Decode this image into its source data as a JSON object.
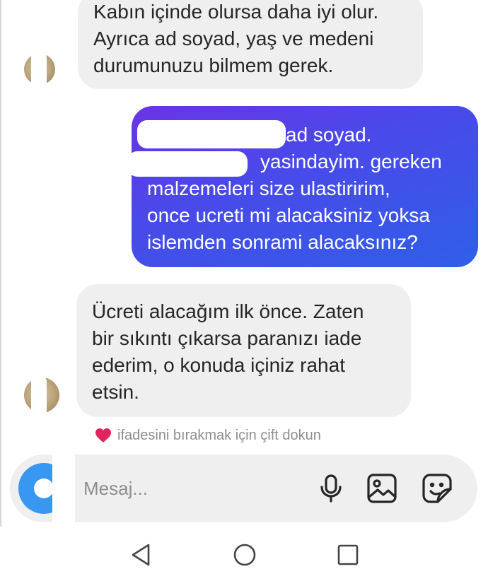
{
  "messages": [
    {
      "direction": "incoming",
      "lines": [
        "Kabın içinde olursa daha iyi olur.",
        "Ayrıca ad soyad, yaş ve medeni",
        "durumunuzu bilmem gerek."
      ]
    },
    {
      "direction": "outgoing",
      "lines": [
        "ad soyad.",
        "yasindayim. gereken",
        "malzemeleri size ulastiririm,",
        "once ucreti mi alacaksiniz yoksa",
        "islemden sonrami alacaksınız?"
      ]
    },
    {
      "direction": "incoming",
      "lines": [
        "Ücreti alacağım ilk önce. Zaten",
        "bir sıkıntı çıkarsa paranızı iade",
        "ederim, o konuda içiniz rahat",
        "etsin."
      ]
    }
  ],
  "reaction_hint": "ifadesini bırakmak için çift dokun",
  "composer": {
    "placeholder": "Mesaj..."
  },
  "icons": {
    "reaction": "heart-icon",
    "camera": "camera-icon",
    "mic": "mic-icon",
    "gallery": "gallery-icon",
    "sticker": "sticker-icon",
    "nav_back": "back-triangle-icon",
    "nav_home": "home-circle-icon",
    "nav_recents": "recents-square-icon"
  },
  "colors": {
    "incoming_bubble": "#efefef",
    "outgoing_gradient_start": "#6a34e6",
    "outgoing_gradient_end": "#2f5fe8",
    "heart": "#e0245e",
    "camera_button": "#3897f0"
  }
}
